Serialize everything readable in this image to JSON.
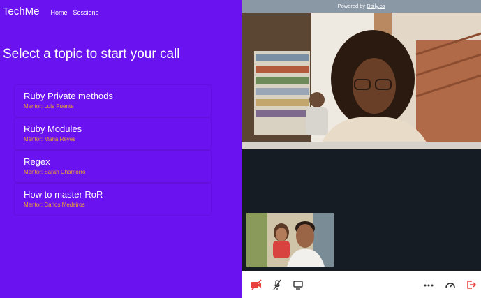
{
  "nav": {
    "brand": "TechMe",
    "links": [
      "Home",
      "Sessions"
    ]
  },
  "heading": "Select a topic to start your call",
  "topics": [
    {
      "title": "Ruby Private methods",
      "mentor": "Mentor: Luis Puente"
    },
    {
      "title": "Ruby Modules",
      "mentor": "Mentor: Maria Reyes"
    },
    {
      "title": "Regex",
      "mentor": "Mentor: Sarah Chamorro"
    },
    {
      "title": "How to master RoR",
      "mentor": "Mentor: Carlos Medeiros"
    }
  ],
  "call": {
    "powered_prefix": "Powered by ",
    "powered_brand": "Daily.co",
    "controls": [
      "camera-off-icon",
      "mic-off-icon",
      "screen-share-icon",
      "more-icon",
      "network-icon",
      "leave-icon"
    ]
  },
  "colors": {
    "primary": "#6b12f0",
    "mentor": "#f0a72a",
    "danger": "#e8413c",
    "call_bg": "#151c24"
  }
}
